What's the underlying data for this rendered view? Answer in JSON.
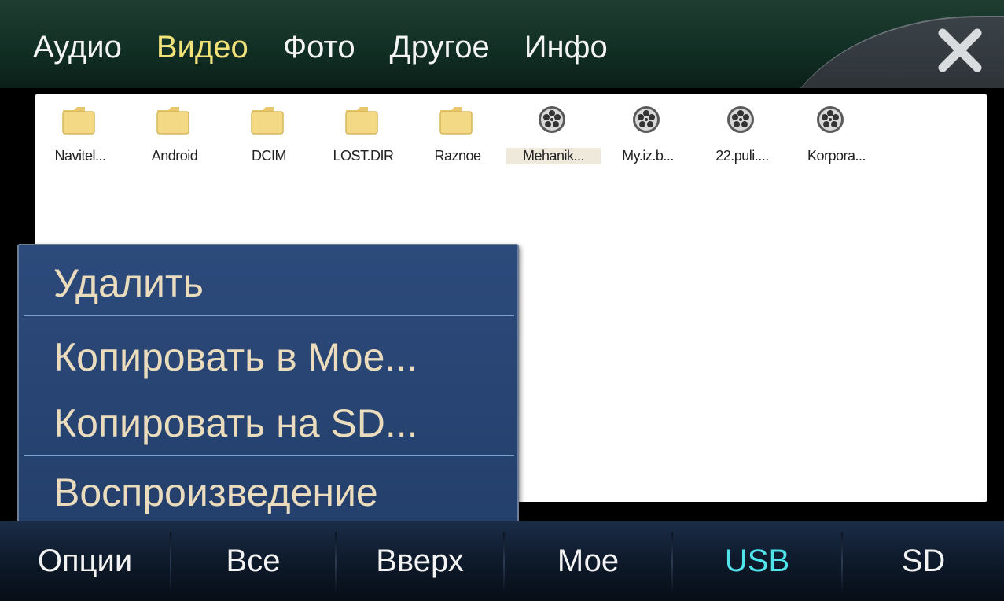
{
  "tabs": [
    {
      "label": "Аудио",
      "active": false
    },
    {
      "label": "Видео",
      "active": true
    },
    {
      "label": "Фото",
      "active": false
    },
    {
      "label": "Другое",
      "active": false
    },
    {
      "label": "Инфо",
      "active": false
    }
  ],
  "files": [
    {
      "name": "Navitel...",
      "type": "folder",
      "icon": "folder-icon"
    },
    {
      "name": "Android",
      "type": "folder",
      "icon": "folder-icon"
    },
    {
      "name": "DCIM",
      "type": "folder",
      "icon": "folder-icon"
    },
    {
      "name": "LOST.DIR",
      "type": "folder",
      "icon": "folder-icon"
    },
    {
      "name": "Raznoe",
      "type": "folder",
      "icon": "folder-icon"
    },
    {
      "name": "Mehanik...",
      "type": "video",
      "icon": "film-reel-icon",
      "selected": true
    },
    {
      "name": "My.iz.b...",
      "type": "video",
      "icon": "film-reel-icon"
    },
    {
      "name": "22.puli....",
      "type": "video",
      "icon": "film-reel-icon"
    },
    {
      "name": "Korpora...",
      "type": "video",
      "icon": "film-reel-icon"
    }
  ],
  "menu": {
    "items": [
      "Удалить",
      "Копировать в Мое...",
      "Копировать на SD...",
      "Воспроизведение"
    ]
  },
  "bottom": {
    "buttons": [
      {
        "label": "Опции",
        "active": false
      },
      {
        "label": "Все",
        "active": false
      },
      {
        "label": "Вверх",
        "active": false
      },
      {
        "label": "Мое",
        "active": false
      },
      {
        "label": "USB",
        "active": true
      },
      {
        "label": "SD",
        "active": false
      }
    ]
  },
  "colors": {
    "active_tab": "#f2e27a",
    "active_source": "#4fe3ea",
    "menu_text": "#eadcbc"
  }
}
